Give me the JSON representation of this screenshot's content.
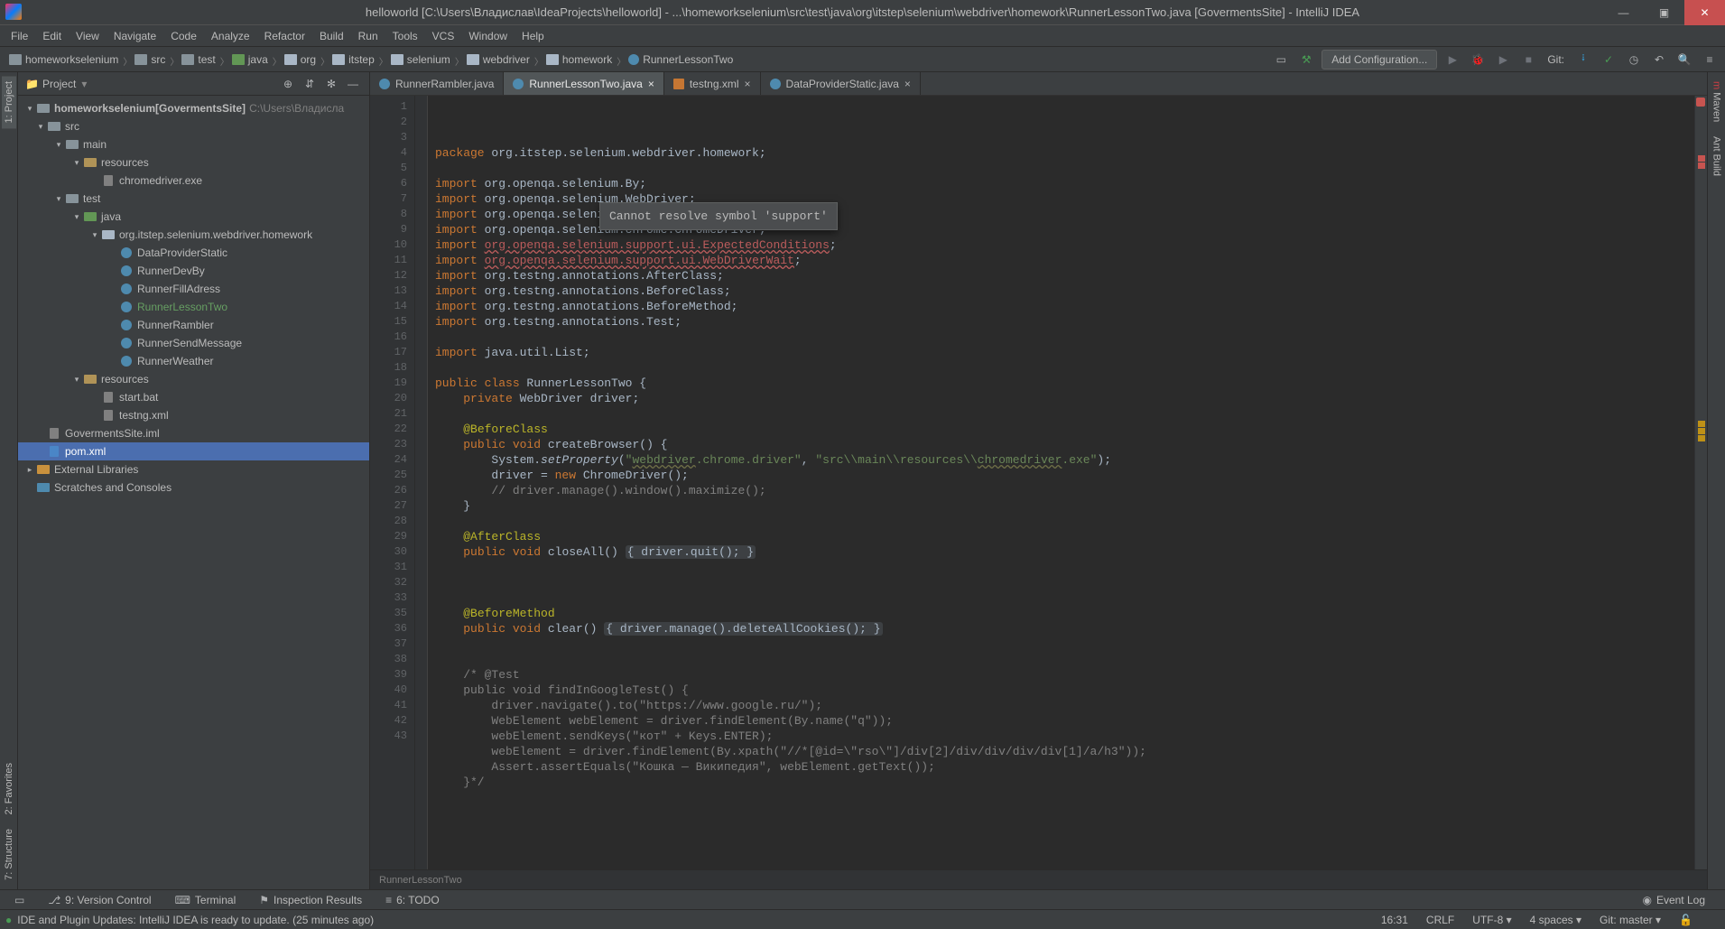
{
  "title": "helloworld [C:\\Users\\Владислав\\IdeaProjects\\helloworld] - ...\\homeworkselenium\\src\\test\\java\\org\\itstep\\selenium\\webdriver\\homework\\RunnerLessonTwo.java [GovermentsSite] - IntelliJ IDEA",
  "menu": [
    "File",
    "Edit",
    "View",
    "Navigate",
    "Code",
    "Analyze",
    "Refactor",
    "Build",
    "Run",
    "Tools",
    "VCS",
    "Window",
    "Help"
  ],
  "breadcrumbs": [
    "homeworkselenium",
    "src",
    "test",
    "java",
    "org",
    "itstep",
    "selenium",
    "webdriver",
    "homework",
    "RunnerLessonTwo"
  ],
  "nav": {
    "add_config": "Add Configuration...",
    "git": "Git:"
  },
  "left_tabs": {
    "project": "1: Project",
    "favorites": "2: Favorites",
    "structure": "7: Structure"
  },
  "right_tabs": {
    "maven": "Maven",
    "ant": "Ant Build"
  },
  "panel": {
    "title": "Project"
  },
  "tree": {
    "root_name": "homeworkselenium",
    "root_mod": "[GovermentsSite]",
    "root_path": "C:\\Users\\Владисла",
    "src": "src",
    "main": "main",
    "resources": "resources",
    "chromedriver": "chromedriver.exe",
    "test": "test",
    "java": "java",
    "pkg": "org.itstep.selenium.webdriver.homework",
    "files": [
      "DataProviderStatic",
      "RunnerDevBy",
      "RunnerFillAdress",
      "RunnerLessonTwo",
      "RunnerRambler",
      "RunnerSendMessage",
      "RunnerWeather"
    ],
    "test_resources": "resources",
    "startbat": "start.bat",
    "testng": "testng.xml",
    "iml": "GovermentsSite.iml",
    "pom": "pom.xml",
    "ext": "External Libraries",
    "scratch": "Scratches and Consoles"
  },
  "tabs": [
    {
      "label": "RunnerRambler.java",
      "active": false,
      "kind": "java"
    },
    {
      "label": "RunnerLessonTwo.java",
      "active": true,
      "kind": "java"
    },
    {
      "label": "testng.xml",
      "active": false,
      "kind": "xml"
    },
    {
      "label": "DataProviderStatic.java",
      "active": false,
      "kind": "java"
    }
  ],
  "tooltip": "Cannot resolve symbol 'support'",
  "editor_crumb": "RunnerLessonTwo",
  "bottom_tools": {
    "vcs": "9: Version Control",
    "terminal": "Terminal",
    "inspect": "Inspection Results",
    "todo": "6: TODO",
    "event": "Event Log"
  },
  "status": {
    "msg": "IDE and Plugin Updates: IntelliJ IDEA is ready to update. (25 minutes ago)",
    "pos": "16:31",
    "le": "CRLF",
    "enc": "UTF-8",
    "indent": "4 spaces",
    "git": "Git: master"
  },
  "code": [
    {
      "n": 1,
      "html": "<span class='kw'>package</span> org.itstep.selenium.webdriver.homework;"
    },
    {
      "n": 2,
      "html": ""
    },
    {
      "n": 3,
      "html": "<span class='kw'>import</span> org.openqa.selenium.By;"
    },
    {
      "n": 4,
      "html": "<span class='kw'>import</span> org.openqa.selenium.WebDriver;"
    },
    {
      "n": 5,
      "html": "<span class='kw'>import</span> org.openqa.selenium.WebElement;"
    },
    {
      "n": 6,
      "html": "<span class='kw'>import</span> org.openqa.selenium.chrome.ChromeDriver;"
    },
    {
      "n": 7,
      "html": "<span class='kw'>import</span> <span class='err'>org.openqa.selenium.support.ui.ExpectedConditions</span>;"
    },
    {
      "n": 8,
      "html": "<span class='kw'>import</span> <span class='err'>org.openqa.selenium.support.ui.WebDriverWait</span>;"
    },
    {
      "n": 9,
      "html": "<span class='kw'>import</span> org.testng.annotations.AfterClass;"
    },
    {
      "n": 10,
      "html": "<span class='kw'>import</span> org.testng.annotations.BeforeClass;"
    },
    {
      "n": 11,
      "html": "<span class='kw'>import</span> org.testng.annotations.BeforeMethod;"
    },
    {
      "n": 12,
      "html": "<span class='kw'>import</span> org.testng.annotations.Test;"
    },
    {
      "n": 13,
      "html": ""
    },
    {
      "n": 14,
      "html": "<span class='kw'>import</span> java.util.List;"
    },
    {
      "n": 15,
      "html": ""
    },
    {
      "n": 16,
      "html": "<span class='kw'>public class</span> RunnerLessonTwo {"
    },
    {
      "n": 17,
      "html": "    <span class='kw'>private</span> WebDriver driver;"
    },
    {
      "n": 18,
      "html": ""
    },
    {
      "n": 19,
      "html": "    <span class='ann'>@BeforeClass</span>"
    },
    {
      "n": 20,
      "html": "    <span class='kw'>public void</span> createBrowser() {"
    },
    {
      "n": 21,
      "html": "        System.<span style='font-style:italic'>setProperty</span>(<span class='str'>\"</span><span class='str warn-u'>webdriver</span><span class='str'>.chrome.driver\"</span>, <span class='str'>\"src\\\\main\\\\resources\\\\</span><span class='str warn-u'>chromedriver</span><span class='str'>.exe\"</span>);"
    },
    {
      "n": 22,
      "html": "        driver = <span class='kw'>new</span> ChromeDriver();"
    },
    {
      "n": 23,
      "html": "        <span class='com'>// driver.manage().window().maximize();</span>"
    },
    {
      "n": 24,
      "html": "    }"
    },
    {
      "n": 25,
      "html": ""
    },
    {
      "n": 26,
      "html": "    <span class='ann'>@AfterClass</span>"
    },
    {
      "n": 27,
      "html": "    <span class='kw'>public void</span> closeAll() <span class='fold-bg'>{ <span class='cls'>driver</span>.quit(); }</span>"
    },
    {
      "n": 28,
      "html": ""
    },
    {
      "n": 29,
      "html": ""
    },
    {
      "n": 30,
      "html": ""
    },
    {
      "n": 31,
      "html": "    <span class='ann'>@BeforeMethod</span>"
    },
    {
      "n": 32,
      "html": "    <span class='kw'>public void</span> clear() <span class='fold-bg'>{ <span class='cls'>driver</span>.manage().deleteAllCookies(); }</span>"
    },
    {
      "n": 33,
      "html": ""
    },
    {
      "n": 35,
      "html": ""
    },
    {
      "n": 36,
      "html": "    <span class='com'>/* @Test</span>"
    },
    {
      "n": 37,
      "html": "<span class='com'>    public void findInGoogleTest() {</span>"
    },
    {
      "n": 38,
      "html": "<span class='com'>        driver.navigate().to(\"https://www.google.ru/\");</span>"
    },
    {
      "n": 39,
      "html": "<span class='com'>        WebElement webElement = driver.findElement(By.name(\"q\"));</span>"
    },
    {
      "n": 40,
      "html": "<span class='com'>        webElement.sendKeys(\"кот\" + Keys.ENTER);</span>"
    },
    {
      "n": 41,
      "html": "<span class='com'>        webElement = driver.findElement(By.xpath(\"//*[@id=\\\"rso\\\"]/div[2]/div/div/div/div[1]/a/h3\"));</span>"
    },
    {
      "n": 42,
      "html": "<span class='com'>        Assert.assertEquals(\"Кошка — Википедия\", webElement.getText());</span>"
    },
    {
      "n": 43,
      "html": "<span class='com'>    }*/</span>"
    }
  ]
}
